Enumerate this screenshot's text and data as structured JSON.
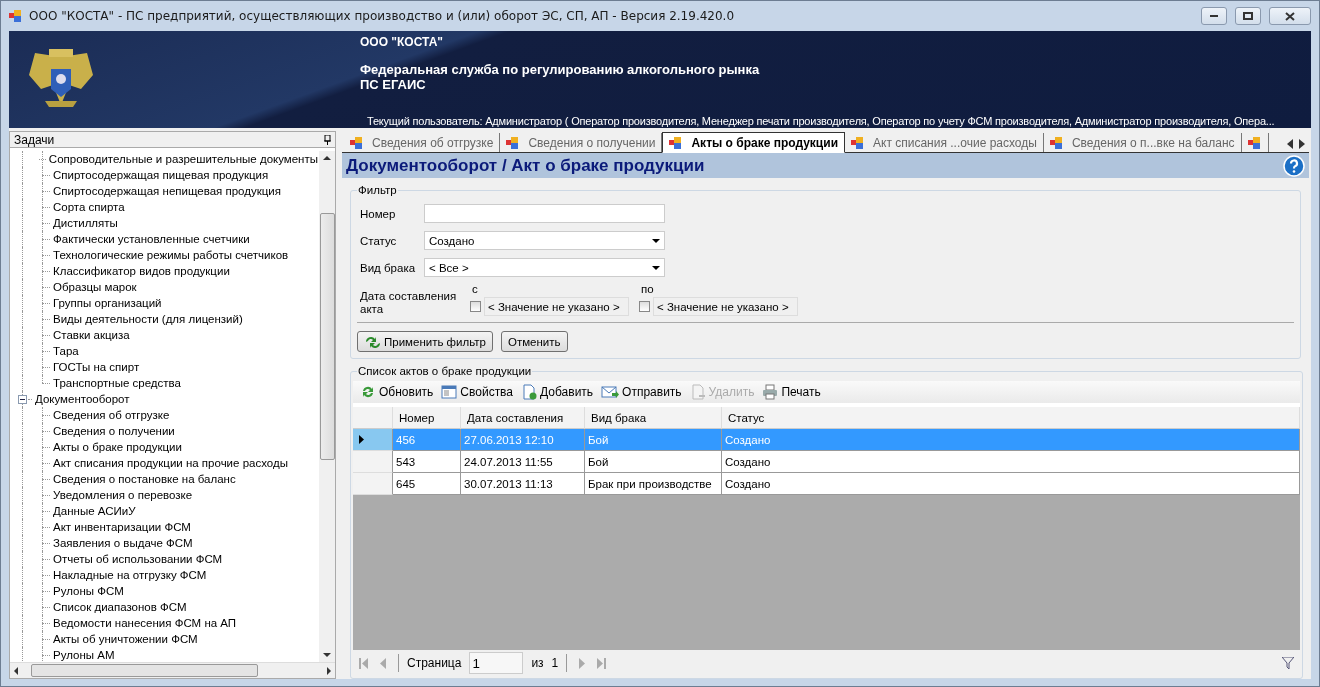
{
  "window": {
    "title": "ООО \"КОСТА\" - ПС предприятий, осуществляющих производство и (или) оборот ЭС, СП, АП - Версия 2.19.420.0"
  },
  "banner": {
    "company": "ООО \"КОСТА\"",
    "agency": "Федеральная служба по регулированию алкогольного рынка",
    "system": "ПС ЕГАИС",
    "user": "Текущий пользователь: Администратор ( Оператор производителя, Менеджер печати производителя, Оператор по учету ФСМ производителя, Администратор производителя, Опера..."
  },
  "tasks": {
    "title": "Задачи",
    "leading_items": [
      "Сопроводительные и разрешительные документы",
      "Спиртосодержащая пищевая продукция",
      "Спиртосодержащая непищевая продукция",
      "Сорта спирта",
      "Дистилляты",
      "Фактически установленные счетчики",
      "Технологические режимы работы счетчиков",
      "Классификатор видов продукции",
      "Образцы марок",
      "Группы организаций",
      "Виды деятельности (для лицензий)",
      "Ставки акциза",
      "Тара",
      "ГОСТы на спирт",
      "Транспортные средства"
    ],
    "nodes": [
      {
        "label": "Документооборот",
        "expanded": true,
        "children": [
          {
            "label": "Сведения об отгрузке"
          },
          {
            "label": "Сведения о получении"
          },
          {
            "label": "Акты о браке продукции"
          },
          {
            "label": "Акт списания продукции на прочие расходы"
          },
          {
            "label": "Сведения о постановке на баланс"
          },
          {
            "label": "Уведомления о перевозке"
          },
          {
            "label": "Данные АСИиУ"
          },
          {
            "label": "Акт инвентаризации ФСМ"
          },
          {
            "label": "Заявления о выдаче ФСМ"
          },
          {
            "label": "Отчеты об использовании ФСМ"
          },
          {
            "label": "Накладные на отгрузку ФСМ"
          },
          {
            "label": "Рулоны ФСМ"
          },
          {
            "label": "Список диапазонов ФСМ"
          },
          {
            "label": "Ведомости нанесения ФСМ на АП"
          },
          {
            "label": "Акты об уничтожении ФСМ"
          },
          {
            "label": "Рулоны АМ"
          }
        ]
      }
    ]
  },
  "tabs": [
    {
      "label": "Сведения об отгрузке",
      "selected": false
    },
    {
      "label": "Сведения о получении",
      "selected": false
    },
    {
      "label": "Акты о браке продукции",
      "selected": true
    },
    {
      "label": "Акт списания ...очие расходы",
      "selected": false
    },
    {
      "label": "Сведения о п...вке на баланс",
      "selected": false
    },
    {
      "selected": false
    }
  ],
  "page_title": "Документооборот / Акт о браке продукции",
  "filter": {
    "title": "Фильтр",
    "number": {
      "label": "Номер"
    },
    "status": {
      "label": "Статус",
      "value": "Создано"
    },
    "defect_type": {
      "label": "Вид брака",
      "value": "< Все >"
    },
    "date": {
      "label": "Дата составления акта",
      "from_label": "с",
      "to_label": "по",
      "from": {
        "checked": false,
        "value": "< Значение не указано >"
      },
      "to": {
        "checked": false,
        "value": "< Значение не указано >"
      }
    },
    "buttons": [
      {
        "label": "Применить фильтр",
        "kind": "apply"
      },
      {
        "label": "Отменить",
        "kind": "plain"
      }
    ]
  },
  "list": {
    "title": "Список актов о браке продукции",
    "toolbar": [
      {
        "label": "Обновить",
        "kind": "refresh",
        "disabled": false
      },
      {
        "label": "Свойства",
        "kind": "properties",
        "disabled": false
      },
      {
        "label": "Добавить",
        "kind": "add",
        "disabled": false
      },
      {
        "label": "Отправить",
        "kind": "send",
        "disabled": false
      },
      {
        "label": "Удалить",
        "kind": "delete",
        "disabled": true
      },
      {
        "label": "Печать",
        "kind": "print",
        "disabled": false
      }
    ],
    "columns": [
      "Номер",
      "Дата составления",
      "Вид брака",
      "Статус"
    ],
    "rows": [
      {
        "selected": true,
        "cells": [
          "456",
          "27.06.2013 12:10",
          "Бой",
          "Создано"
        ]
      },
      {
        "selected": false,
        "cells": [
          "543",
          "24.07.2013 11:55",
          "Бой",
          "Создано"
        ]
      },
      {
        "selected": false,
        "cells": [
          "645",
          "30.07.2013 11:13",
          "Брак при производстве",
          "Создано"
        ]
      }
    ],
    "pager": {
      "label": "Страница",
      "page": "1",
      "of_label": "из",
      "total": "1"
    }
  }
}
